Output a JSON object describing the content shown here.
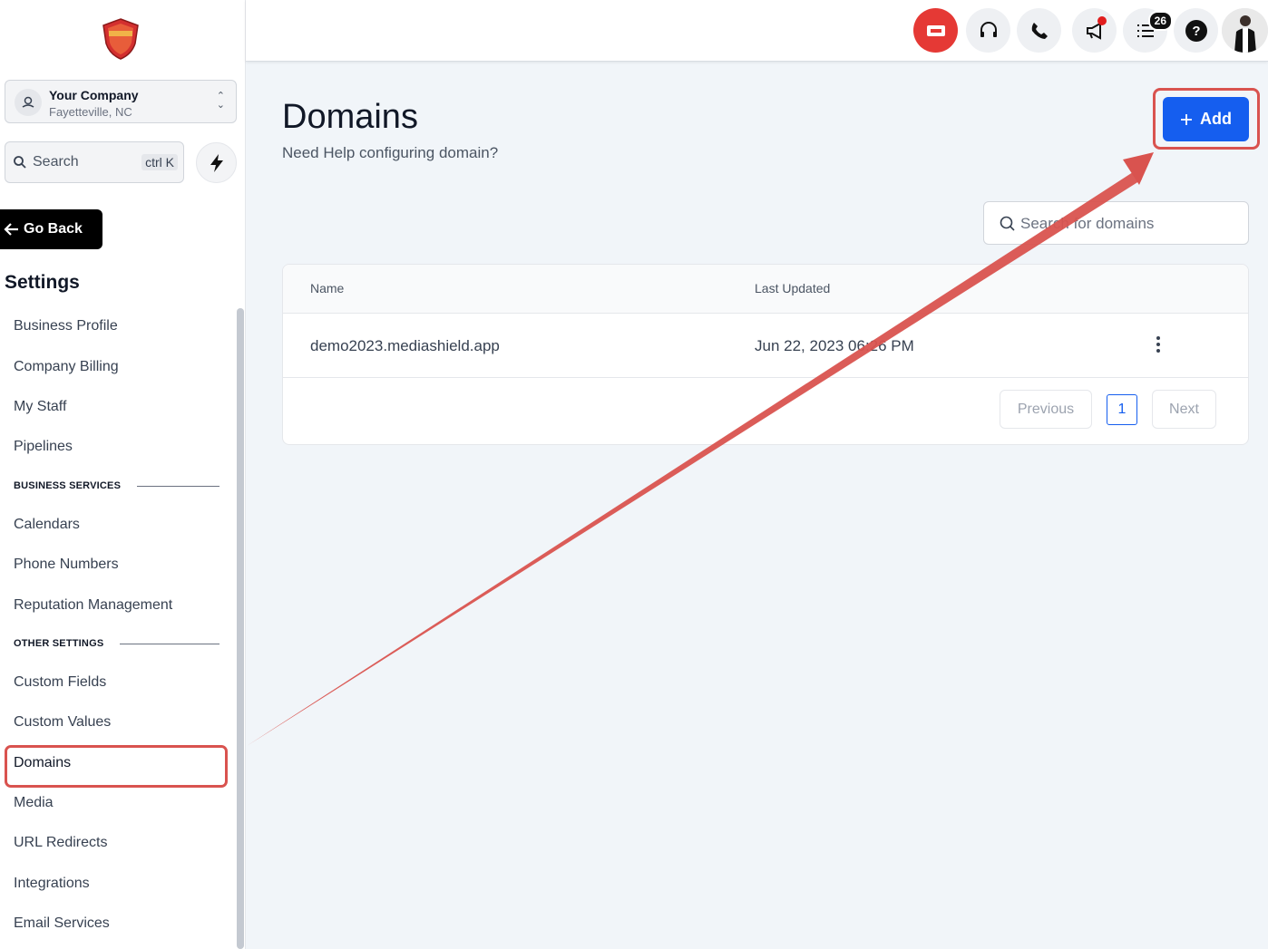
{
  "sidebar": {
    "company": {
      "name": "Your Company",
      "location": "Fayetteville, NC"
    },
    "search": {
      "label": "Search",
      "shortcut": "ctrl K"
    },
    "go_back": "Go Back",
    "settings_title": "Settings",
    "items_group1": [
      "Business Profile",
      "Company Billing",
      "My Staff",
      "Pipelines"
    ],
    "section_business": "BUSINESS SERVICES",
    "items_group2": [
      "Calendars",
      "Phone Numbers",
      "Reputation Management"
    ],
    "section_other": "OTHER SETTINGS",
    "items_group3": [
      "Custom Fields",
      "Custom Values",
      "Domains",
      "Media",
      "URL Redirects",
      "Integrations",
      "Email Services"
    ],
    "active_item": "Domains"
  },
  "topbar": {
    "icons": [
      "ticket-icon",
      "headset-icon",
      "phone-icon",
      "megaphone-icon",
      "task-list-icon",
      "help-icon"
    ],
    "notification_count": "26",
    "brand_red": "#e53935"
  },
  "main": {
    "title": "Domains",
    "subtitle": "Need Help configuring domain?",
    "add_label": "Add",
    "search_placeholder": "Search for domains",
    "table": {
      "columns": [
        "Name",
        "Last Updated"
      ],
      "rows": [
        {
          "name": "demo2023.mediashield.app",
          "updated": "Jun 22, 2023 06:26 PM"
        }
      ]
    },
    "pagination": {
      "previous": "Previous",
      "page": "1",
      "next": "Next"
    },
    "accent": "#155eef",
    "annotation_color": "#d9534f"
  }
}
